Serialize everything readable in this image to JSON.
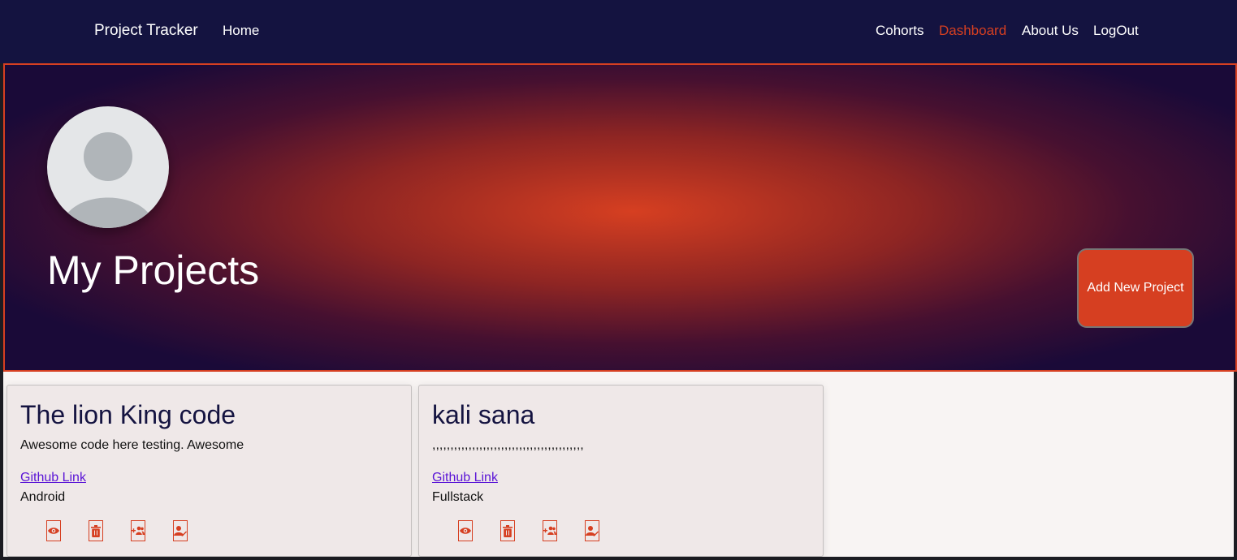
{
  "nav": {
    "brand": "Project Tracker",
    "home": "Home",
    "cohorts": "Cohorts",
    "dashboard": "Dashboard",
    "about": "About Us",
    "logout": "LogOut"
  },
  "hero": {
    "title": "My Projects",
    "add_button": "Add New Project"
  },
  "projects": [
    {
      "title": "The lion King code",
      "description": "Awesome code here testing. Awesome",
      "link": "Github Link",
      "category": "Android",
      "actions": [
        "view-icon",
        "delete-icon",
        "add-member-icon",
        "edit-member-icon"
      ]
    },
    {
      "title": "kali sana",
      "description": ",,,,,,,,,,,,,,,,,,,,,,,,,,,,,,,,,,,,,,,,,,",
      "link": "Github Link",
      "category": "Fullstack",
      "actions": [
        "view-icon",
        "delete-icon",
        "add-member-icon",
        "edit-member-icon"
      ]
    }
  ],
  "colors": {
    "navbar": "#141340",
    "accent": "#d63f21",
    "card_bg": "#efe8e8",
    "link": "#5a14d6"
  }
}
